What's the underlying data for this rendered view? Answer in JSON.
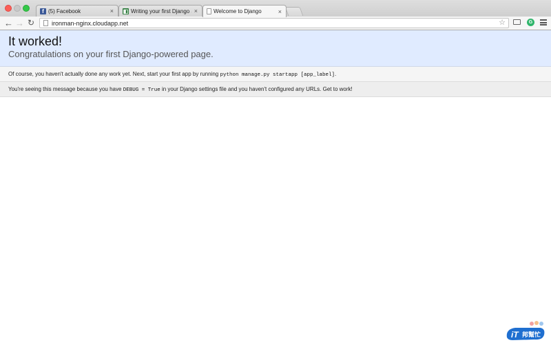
{
  "browser": {
    "tabs": [
      {
        "label": "(5) Facebook",
        "favicon": "facebook-icon",
        "active": false
      },
      {
        "label": "Writing your first Django ap",
        "favicon": "ithome-icon",
        "active": false
      },
      {
        "label": "Welcome to Django",
        "favicon": "page-icon",
        "active": true
      }
    ],
    "tab_close_glyph": "×",
    "address_bar": {
      "url": "ironman-nginx.cloudapp.net"
    },
    "toolbar_icons": [
      "back-arrow-icon",
      "forward-arrow-icon",
      "reload-icon",
      "star-icon",
      "cast-icon",
      "extension-icon",
      "menu-icon"
    ],
    "extension_letter": "G"
  },
  "page": {
    "summary": {
      "title": "It worked!",
      "subtitle": "Congratulations on your first Django-powered page."
    },
    "instructions": {
      "text_before": "Of course, you haven't actually done any work yet. Next, start your first app by running",
      "command": "python manage.py startapp [app_label]",
      "text_after": "."
    },
    "explanation": {
      "text_before": "You're seeing this message because you have",
      "code": "DEBUG = True",
      "text_after": "in your Django settings file and you haven't configured any URLs. Get to work!"
    }
  },
  "watermark": {
    "logo": "ithome-ironman-logo",
    "text": "iT邦幫忙"
  },
  "colors": {
    "summary_bg": "#e0ebff",
    "instructions_bg": "#f5f5f5",
    "explanation_bg": "#eeeeee",
    "watermark_blue": "#1f6fd0"
  }
}
